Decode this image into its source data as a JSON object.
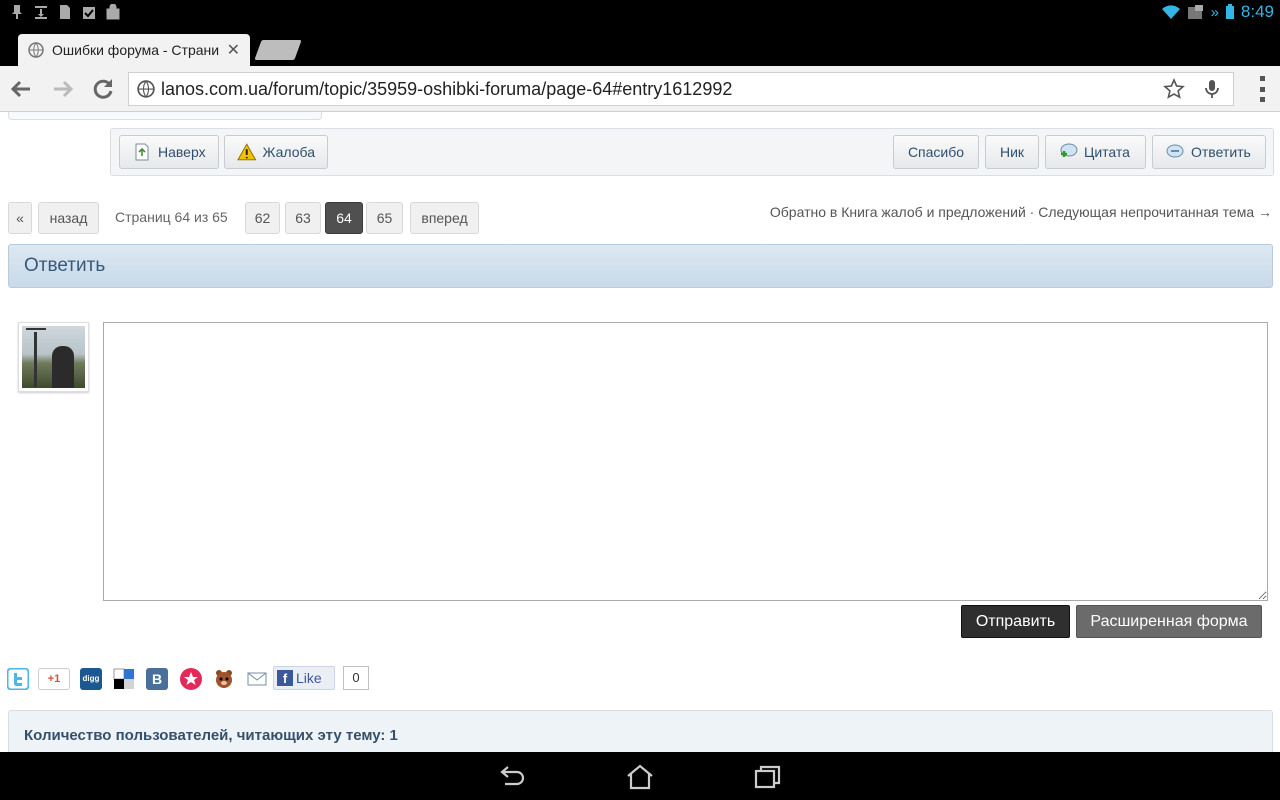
{
  "status_bar": {
    "time": "8:49"
  },
  "browser": {
    "tab_title": "Ошибки форума - Страни",
    "url": "lanos.com.ua/forum/topic/35959-oshibki-foruma/page-64#entry1612992"
  },
  "post_actions": {
    "top_label": "Наверх",
    "report_label": "Жалоба",
    "thanks_label": "Спасибо",
    "nick_label": "Ник",
    "quote_label": "Цитата",
    "reply_label": "Ответить"
  },
  "pagination": {
    "first": "«",
    "prev": "назад",
    "info": "Страниц 64 из 65",
    "pages": [
      "62",
      "63",
      "64",
      "65"
    ],
    "current": "64",
    "next": "вперед"
  },
  "back_links": "Обратно в Книга жалоб и предложений · Следующая непрочитанная тема →",
  "reply_section": {
    "title": "Ответить",
    "editor_value": "",
    "submit_label": "Отправить",
    "advanced_label": "Расширенная форма"
  },
  "share": {
    "gplus_label": "+1",
    "digg_label": "digg",
    "vk_label": "B",
    "fb_like_label": "Like",
    "fb_like_count": "0"
  },
  "readers": {
    "text": "Количество пользователей, читающих эту тему: 1"
  }
}
